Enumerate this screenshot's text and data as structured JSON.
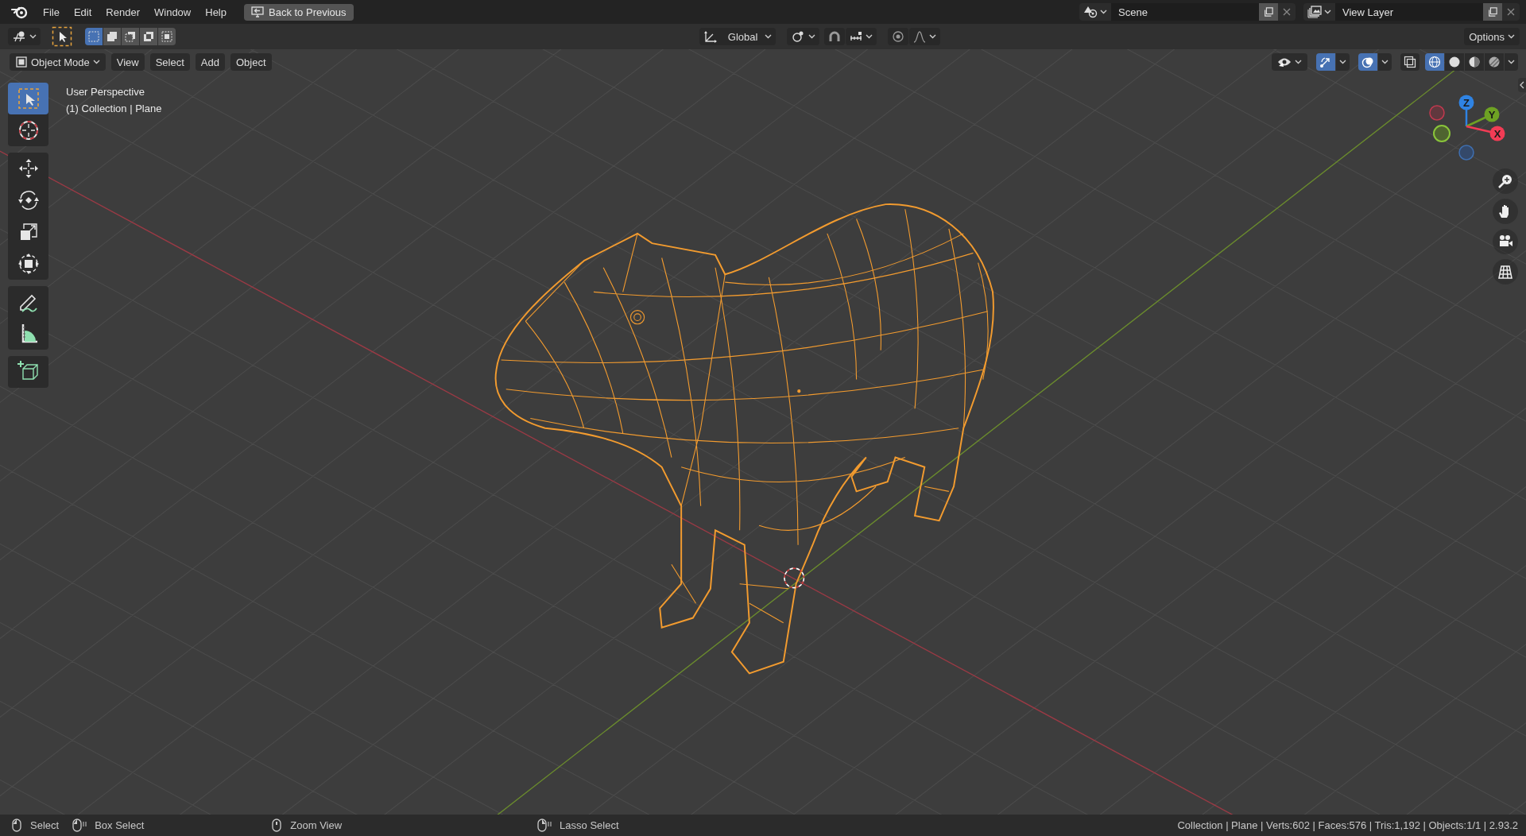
{
  "menu_bar": {
    "menus": [
      "File",
      "Edit",
      "Render",
      "Window",
      "Help"
    ],
    "back_button": "Back to Previous",
    "scene": "Scene",
    "view_layer": "View Layer"
  },
  "tool_header": {
    "select_modes": [
      {
        "kind": "set",
        "selected": true
      },
      {
        "kind": "extend",
        "selected": false
      },
      {
        "kind": "subtract",
        "selected": false
      },
      {
        "kind": "difference",
        "selected": false
      },
      {
        "kind": "intersect",
        "selected": false
      }
    ],
    "orientation": "Global",
    "options": "Options"
  },
  "viewport_header": {
    "mode": "Object Mode",
    "menus": [
      "View",
      "Select",
      "Add",
      "Object"
    ],
    "toggles": [
      {
        "kind": "gizmo",
        "on": true
      },
      {
        "kind": "overlay",
        "on": true
      },
      {
        "kind": "xray",
        "on": false
      }
    ],
    "shading": [
      {
        "kind": "wireframe",
        "selected": true
      },
      {
        "kind": "solid",
        "selected": false
      },
      {
        "kind": "material",
        "selected": false
      },
      {
        "kind": "rendered",
        "selected": false
      }
    ]
  },
  "toolbar": {
    "groups": [
      {
        "tools": [
          {
            "kind": "select",
            "selected": true
          },
          {
            "kind": "cursor",
            "selected": false
          }
        ]
      },
      {
        "tools": [
          {
            "kind": "move",
            "selected": false
          },
          {
            "kind": "rotate",
            "selected": false
          },
          {
            "kind": "scale",
            "selected": false
          },
          {
            "kind": "transform",
            "selected": false
          }
        ]
      },
      {
        "tools": [
          {
            "kind": "annotate",
            "selected": false
          },
          {
            "kind": "measure",
            "selected": false
          }
        ]
      },
      {
        "tools": [
          {
            "kind": "add-cube",
            "selected": false
          }
        ]
      }
    ]
  },
  "viewport": {
    "overlay_text": [
      "User Perspective",
      "(1) Collection | Plane"
    ],
    "gizmo_axes": [
      {
        "label": "Z",
        "color": "#2f83e3"
      },
      {
        "label": "Y",
        "color": "#6ea223"
      },
      {
        "label": "X",
        "color": "#f23c55"
      }
    ]
  },
  "status_bar": {
    "hints": [
      {
        "kind": "left",
        "label": "Select"
      },
      {
        "kind": "drag",
        "label": "Box Select"
      },
      {
        "kind": "middle",
        "label": "Zoom View"
      },
      {
        "kind": "right-drag",
        "label": "Lasso Select"
      }
    ],
    "stats": "Collection | Plane | Verts:602 | Faces:576 | Tris:1,192 | Objects:1/1 | 2.93.2"
  }
}
